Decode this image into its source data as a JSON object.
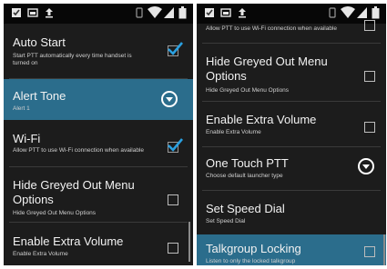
{
  "left": {
    "items": [
      {
        "title": "Auto Start",
        "subtitle": "Start PTT automatically every time handset is turned on"
      },
      {
        "title": "Alert Tone",
        "subtitle": "Alert 1"
      },
      {
        "title": "Wi-Fi",
        "subtitle": "Allow PTT to use Wi-Fi connection when available"
      },
      {
        "title": "Hide Greyed Out Menu Options",
        "subtitle": "Hide Greyed Out Menu Options"
      },
      {
        "title": "Enable Extra Volume",
        "subtitle": "Enable Extra Volume"
      }
    ]
  },
  "right": {
    "items": [
      {
        "title": "",
        "subtitle": "Allow PTT to use Wi-Fi connection when available"
      },
      {
        "title": "Hide Greyed Out Menu Options",
        "subtitle": "Hide Greyed Out Menu Options"
      },
      {
        "title": "Enable Extra Volume",
        "subtitle": "Enable Extra Volume"
      },
      {
        "title": "One Touch PTT",
        "subtitle": "Choose default launcher type"
      },
      {
        "title": "Set Speed Dial",
        "subtitle": "Set Speed Dial"
      },
      {
        "title": "Talkgroup Locking",
        "subtitle": "Listen to only the locked talkgroup"
      }
    ]
  },
  "colors": {
    "highlight": "#2b6d8c",
    "check": "#2aa0e0",
    "background": "#1c1c1c"
  },
  "icons": [
    "checkbox-notification-icon",
    "screenshot-notification-icon",
    "upload-notification-icon",
    "vibrate-icon",
    "wifi-signal-icon",
    "cell-signal-icon",
    "battery-icon"
  ]
}
